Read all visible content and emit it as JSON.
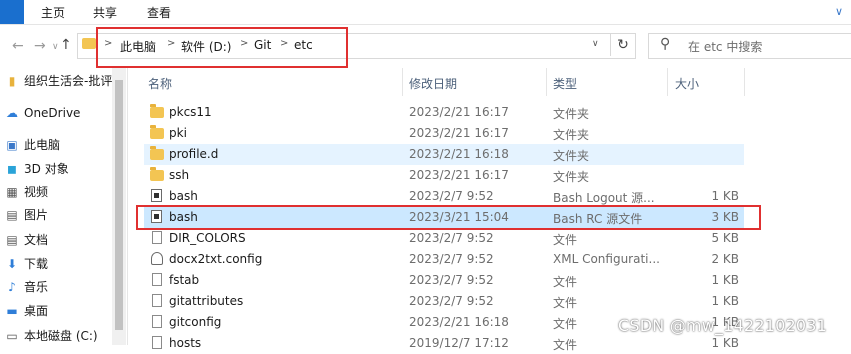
{
  "ribbon": {
    "tabs": [
      "主页",
      "共享",
      "查看"
    ]
  },
  "address": {
    "segments": [
      "此电脑",
      "软件 (D:)",
      "Git",
      "etc"
    ]
  },
  "search": {
    "placeholder": "在 etc 中搜索"
  },
  "sidebar": {
    "items": [
      {
        "label": "组织生活会-批评",
        "icon": "folder-icon"
      },
      {
        "label": "OneDrive",
        "icon": "cloud-icon"
      },
      {
        "label": "此电脑",
        "icon": "computer-icon"
      },
      {
        "label": "3D 对象",
        "icon": "cube-icon"
      },
      {
        "label": "视频",
        "icon": "video-icon"
      },
      {
        "label": "图片",
        "icon": "picture-icon"
      },
      {
        "label": "文档",
        "icon": "document-icon"
      },
      {
        "label": "下载",
        "icon": "download-icon"
      },
      {
        "label": "音乐",
        "icon": "music-icon"
      },
      {
        "label": "桌面",
        "icon": "desktop-icon"
      },
      {
        "label": "本地磁盘 (C:)",
        "icon": "drive-icon"
      }
    ]
  },
  "columns": {
    "name": "名称",
    "date": "修改日期",
    "type": "类型",
    "size": "大小"
  },
  "files": [
    {
      "name": "pkcs11",
      "date": "2023/2/21 16:17",
      "type": "文件夹",
      "size": "",
      "icon": "folder-icon"
    },
    {
      "name": "pki",
      "date": "2023/2/21 16:17",
      "type": "文件夹",
      "size": "",
      "icon": "folder-icon"
    },
    {
      "name": "profile.d",
      "date": "2023/2/21 16:18",
      "type": "文件夹",
      "size": "",
      "icon": "folder-icon"
    },
    {
      "name": "ssh",
      "date": "2023/2/21 16:17",
      "type": "文件夹",
      "size": "",
      "icon": "folder-icon"
    },
    {
      "name": "bash",
      "date": "2023/2/7 9:52",
      "type": "Bash Logout 源...",
      "size": "1 KB",
      "icon": "bash-file-icon"
    },
    {
      "name": "bash",
      "date": "2023/3/21 15:04",
      "type": "Bash RC 源文件",
      "size": "3 KB",
      "icon": "bash-file-icon"
    },
    {
      "name": "DIR_COLORS",
      "date": "2023/2/7 9:52",
      "type": "文件",
      "size": "5 KB",
      "icon": "file-icon"
    },
    {
      "name": "docx2txt.config",
      "date": "2023/2/7 9:52",
      "type": "XML Configurati...",
      "size": "2 KB",
      "icon": "config-file-icon"
    },
    {
      "name": "fstab",
      "date": "2023/2/7 9:52",
      "type": "文件",
      "size": "1 KB",
      "icon": "file-icon"
    },
    {
      "name": "gitattributes",
      "date": "2023/2/7 9:52",
      "type": "文件",
      "size": "1 KB",
      "icon": "file-icon"
    },
    {
      "name": "gitconfig",
      "date": "2023/2/21 16:18",
      "type": "文件",
      "size": "1 KB",
      "icon": "file-icon"
    },
    {
      "name": "hosts",
      "date": "2019/12/7 17:12",
      "type": "文件",
      "size": "1 KB",
      "icon": "file-icon"
    }
  ],
  "watermark": "CSDN @mw_1422102031"
}
